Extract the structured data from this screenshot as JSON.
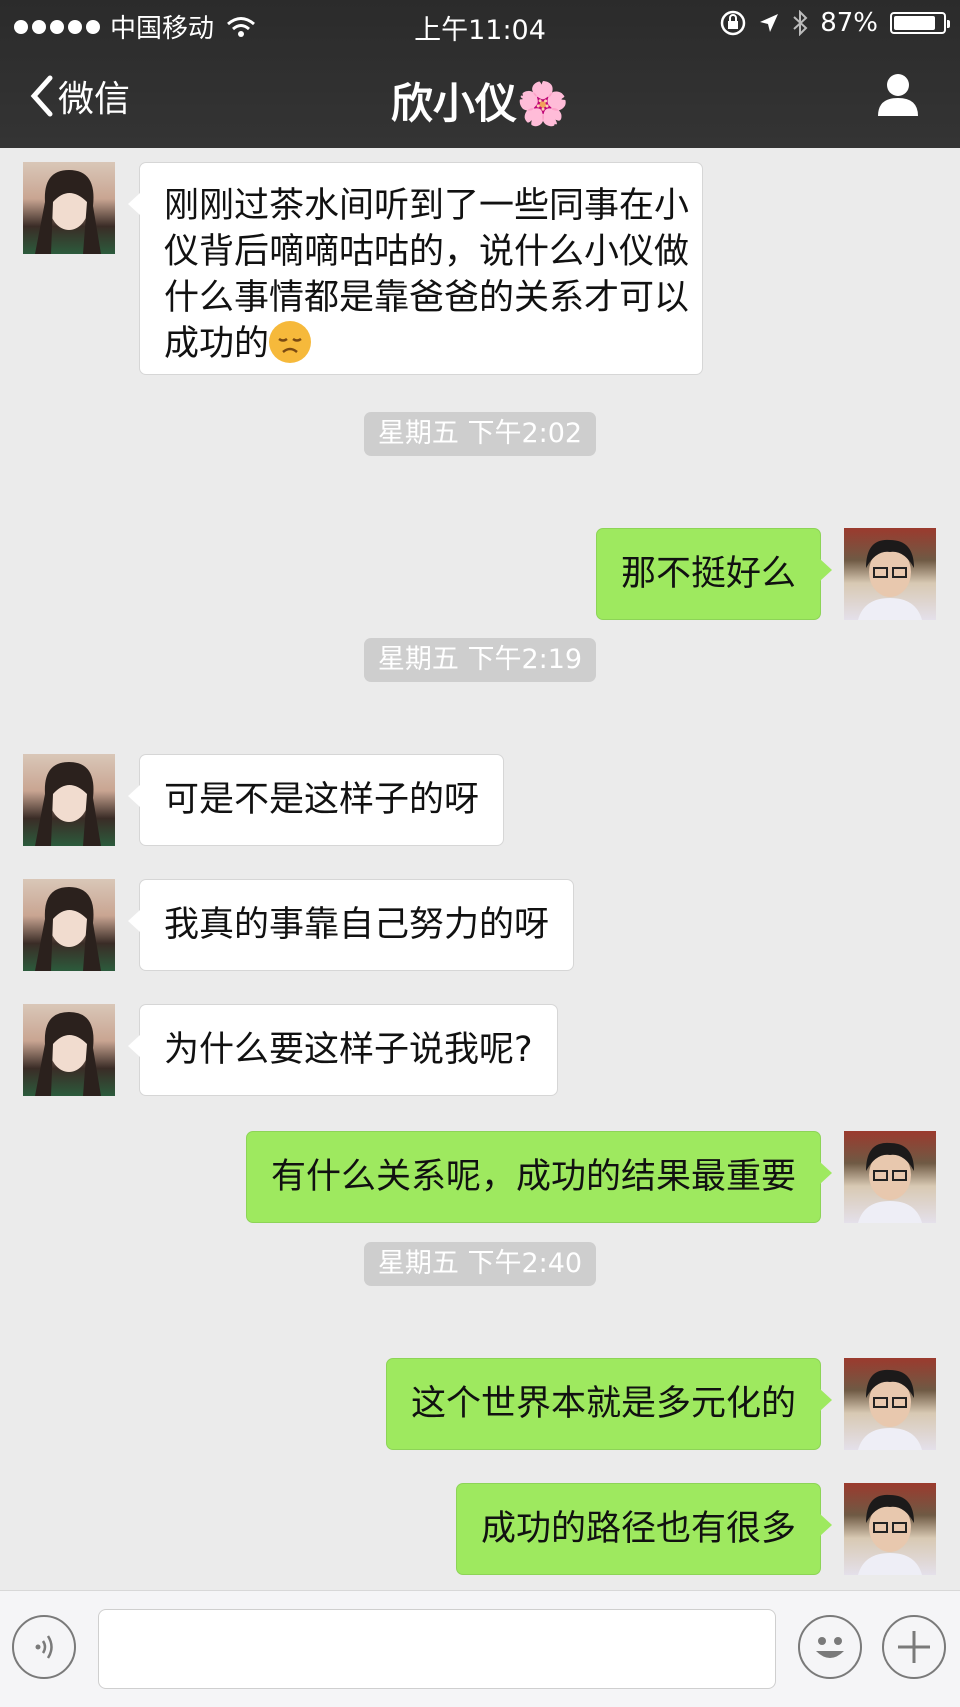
{
  "status_bar": {
    "carrier": "中国移动",
    "time": "上午11:04",
    "battery_text": "87%",
    "battery_level": 0.87
  },
  "nav": {
    "back_label": "微信",
    "title": "欣小仪🌸"
  },
  "messages": [
    {
      "sender": "contact",
      "text_lines": [
        "刚刚过茶水间听到了一些同事在小",
        "仪背后嘀嘀咕咕的，说什么小仪做",
        "什么事情都是靠爸爸的关系才可以",
        "成功的"
      ],
      "emoji": "disappointed-face"
    },
    {
      "type": "timestamp",
      "text": "星期五 下午2:02"
    },
    {
      "sender": "me",
      "text": "那不挺好么"
    },
    {
      "type": "timestamp",
      "text": "星期五 下午2:19"
    },
    {
      "sender": "contact",
      "text": "可是不是这样子的呀"
    },
    {
      "sender": "contact",
      "text": "我真的事靠自己努力的呀"
    },
    {
      "sender": "contact",
      "text": "为什么要这样子说我呢?"
    },
    {
      "sender": "me",
      "text": "有什么关系呢，成功的结果最重要"
    },
    {
      "type": "timestamp",
      "text": "星期五 下午2:40"
    },
    {
      "sender": "me",
      "text": "这个世界本就是多元化的"
    },
    {
      "sender": "me",
      "text": "成功的路径也有很多"
    }
  ],
  "input_bar": {
    "value": "",
    "icons": [
      "voice-icon",
      "emoji-icon",
      "plus-icon"
    ]
  },
  "colors": {
    "nav_bg": "#2e2e2e",
    "chat_bg": "#ebebeb",
    "outgoing_bubble": "#9ee95f",
    "incoming_bubble": "#ffffff",
    "timestamp_bg": "#cecece"
  }
}
